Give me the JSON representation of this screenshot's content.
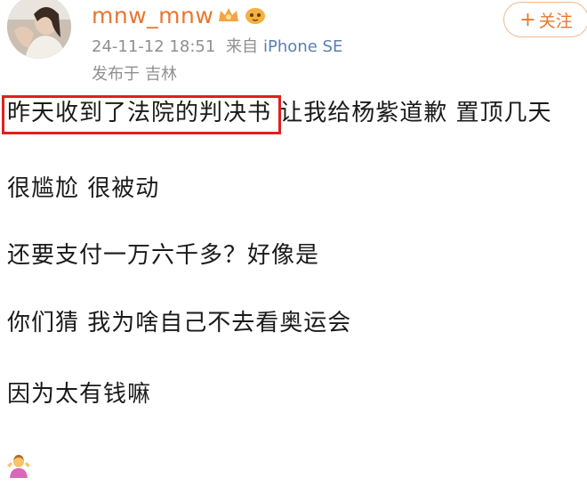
{
  "post": {
    "username": "mnw_mnw",
    "timestamp": "24-11-12 18:51",
    "source_prefix": "来自",
    "device": "iPhone SE",
    "location_prefix": "发布于",
    "location": "吉林",
    "follow_label": "关注",
    "follow_icon": "plus-icon",
    "badge_icon": "member-crown-icon",
    "highlight_color": "#e0201c",
    "username_color": "#e8772e",
    "lines": [
      {
        "highlighted": "昨天收到了法院的判决书",
        "rest": " 让我给杨紫道歉 置顶几天"
      },
      {
        "text": "很尴尬 很被动"
      },
      {
        "text": "还要支付一万六千多？好像是"
      },
      {
        "text": "你们猜 我为啥自己不去看奥运会"
      },
      {
        "text": "因为太有钱嘛"
      }
    ],
    "ending_emoji": "person-shrugging-emoji"
  }
}
